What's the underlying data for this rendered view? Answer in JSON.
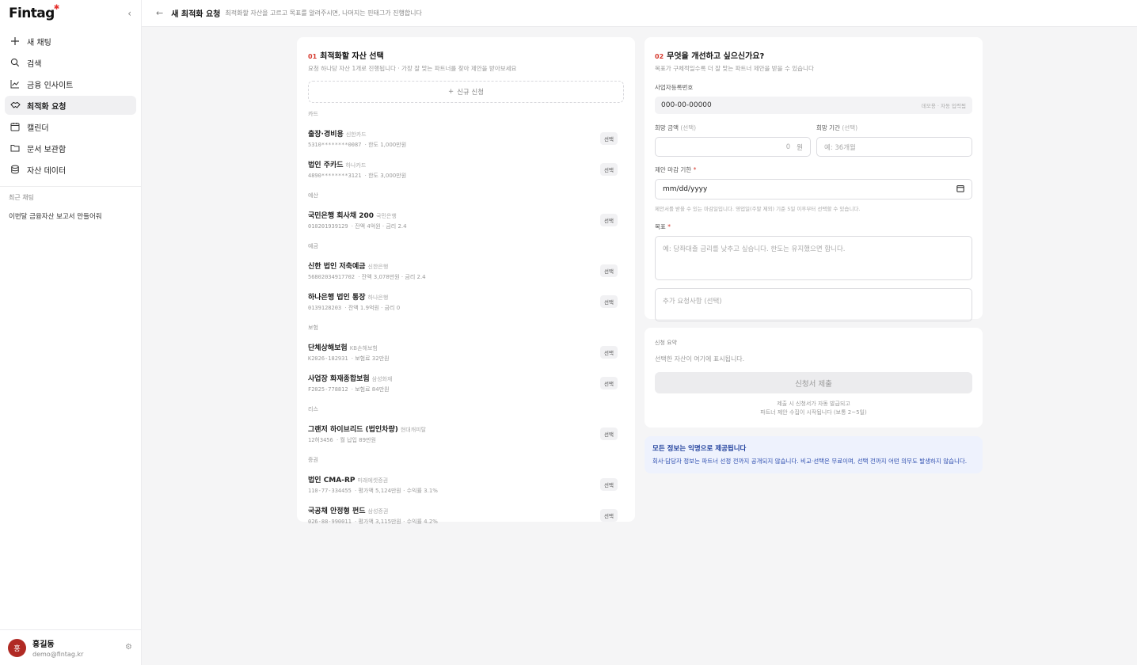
{
  "app": {
    "logo": "Fintag"
  },
  "sidebar": {
    "items": [
      {
        "label": "새 채팅",
        "icon": "plus-icon"
      },
      {
        "label": "검색",
        "icon": "search-icon"
      },
      {
        "label": "금융 인사이트",
        "icon": "chart-line-icon"
      },
      {
        "label": "최적화 요청",
        "icon": "handshake-icon",
        "active": true
      },
      {
        "label": "캘린더",
        "icon": "calendar-icon"
      },
      {
        "label": "문서 보관함",
        "icon": "folder-icon"
      },
      {
        "label": "자산 데이터",
        "icon": "database-icon"
      }
    ],
    "recent_title": "최근 채팅",
    "recent_items": [
      "이번달 금융자산 보고서 만들어줘"
    ]
  },
  "user": {
    "avatar_initial": "홍",
    "name": "홍길동",
    "email": "demo@fintag.kr"
  },
  "header": {
    "title": "새 최적화 요청",
    "subtitle": "최적화할 자산을 고르고 목표를 알려주시면, 나머지는 핀태그가 진행합니다"
  },
  "left": {
    "num": "01",
    "title": "최적화할 자산 선택",
    "subtitle": "요청 하나당 자산 1개로 진행됩니다 · 가장 잘 맞는 파트너를 찾아 제안을 받아보세요",
    "new_button": "신규 신청",
    "select_label": "선택",
    "categories": [
      {
        "label": "카드",
        "assets": [
          {
            "name": "출장·경비용",
            "issuer": "신한카드",
            "code": "5310********0087",
            "meta": "· 한도 1,000만원"
          },
          {
            "name": "법인 주카드",
            "issuer": "하나카드",
            "code": "4890********3121",
            "meta": "· 한도 3,000만원"
          }
        ]
      },
      {
        "label": "예산",
        "assets": [
          {
            "name": "국민은행 회사채 200",
            "issuer": "국민은행",
            "code": "010201939129",
            "meta": "· 잔액 4억원 · 금리 2.4"
          }
        ]
      },
      {
        "label": "예금",
        "assets": [
          {
            "name": "신한 법인 저축예금",
            "issuer": "신한은행",
            "code": "56802034917702",
            "meta": "· 잔액 3,078만원 · 금리 2.4"
          },
          {
            "name": "하나은행 법인 통장",
            "issuer": "하나은행",
            "code": "0139128203",
            "meta": "· 잔액 1.9억원 · 금리 0"
          }
        ]
      },
      {
        "label": "보험",
        "assets": [
          {
            "name": "단체상해보험",
            "issuer": "KB손해보험",
            "code": "K2026-182931",
            "meta": "· 보험료 32만원"
          },
          {
            "name": "사업장 화재종합보험",
            "issuer": "삼성화재",
            "code": "F2025-778812",
            "meta": "· 보험료 84만원"
          }
        ]
      },
      {
        "label": "리스",
        "assets": [
          {
            "name": "그랜저 하이브리드 (법인차량)",
            "issuer": "현대캐피탈",
            "code": "12허3456",
            "meta": "· 월 납입 89만원"
          }
        ]
      },
      {
        "label": "증권",
        "assets": [
          {
            "name": "법인 CMA-RP",
            "issuer": "미래에셋증권",
            "code": "110-77-334455",
            "meta": "· 평가액 5,124만원 · 수익률 3.1%"
          },
          {
            "name": "국공채 안정형 펀드",
            "issuer": "삼성증권",
            "code": "026-88-990011",
            "meta": "· 평가액 3,115만원 · 수익률 4.2%"
          }
        ]
      }
    ]
  },
  "right": {
    "num": "02",
    "title": "무엇을 개선하고 싶으신가요?",
    "subtitle": "목표가 구체적일수록 더 잘 맞는 파트너 제안을 받을 수 있습니다",
    "biz_label": "사업자등록번호",
    "biz_value": "000-00-00000",
    "biz_hint": "데모용 · 자동 입력됨",
    "amount_label": "희망 금액",
    "amount_opt": "(선택)",
    "amount_value": "0",
    "amount_unit": "원",
    "period_label": "희망 기간",
    "period_opt": "(선택)",
    "period_placeholder": "예: 36개월",
    "deadline_label": "제안 마감 기한",
    "required_mark": "*",
    "deadline_value": "mm/dd/yyyy",
    "deadline_help": "제안서를 받을 수 있는 마감일입니다. 영업일(주말 제외) 기준 5일 이후부터 선택할 수 있습니다.",
    "goal_label": "목표",
    "goal_placeholder": "예: 당좌대출 금리를 낮추고 싶습니다. 한도는 유지했으면 합니다.",
    "extra_placeholder": "추가 요청사항 (선택)"
  },
  "summary": {
    "label": "신청 요약",
    "text": "선택한 자산이 여기에 표시됩니다.",
    "submit": "신청서 제출",
    "note_line1": "제출 시 신청서가 자동 발급되고",
    "note_line2": "파트너 제안 수집이 시작됩니다 (보통 2~5일)"
  },
  "notice": {
    "title": "모든 정보는 익명으로 제공됩니다",
    "body": "회사·담당자 정보는 파트너 선정 전까지 공개되지 않습니다. 비교·선택은 무료이며, 선택 전까지 어떤 의무도 발생하지 않습니다."
  },
  "colors": {
    "accent_red": "#d63a2f",
    "notice_blue": "#1f3f9c",
    "active_bg": "#f0f0f2"
  }
}
